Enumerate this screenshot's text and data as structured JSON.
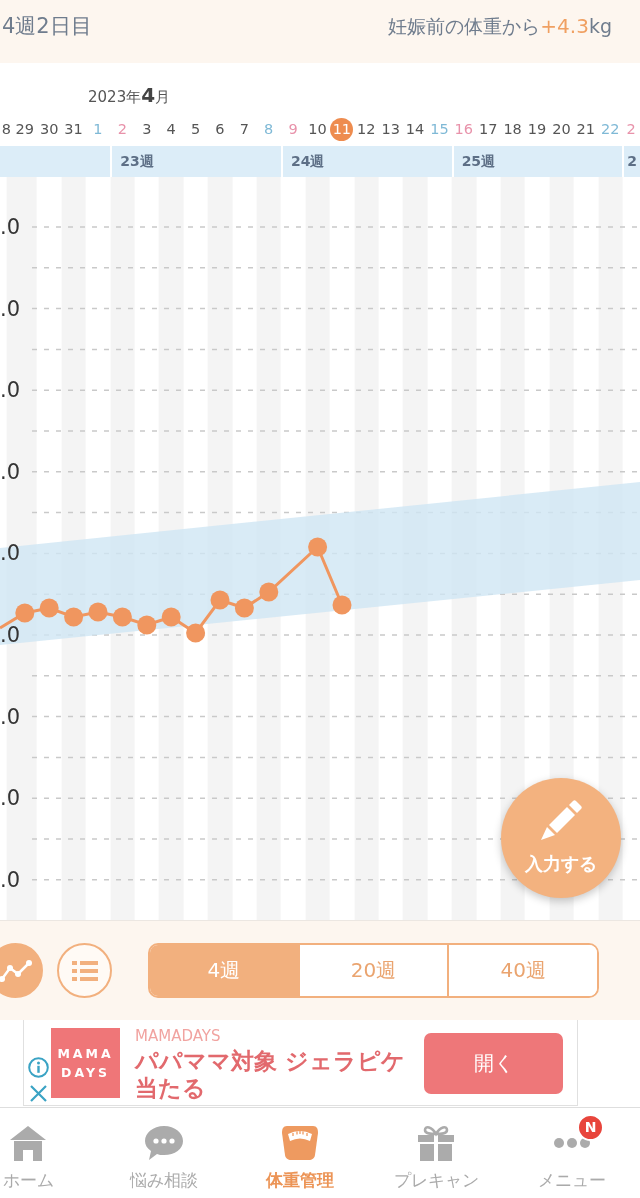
{
  "header": {
    "week_day": "4週2日目",
    "gain_label": "妊娠前の体重から",
    "gain_value": "+4.3",
    "gain_unit": "kg"
  },
  "calendar": {
    "month": "2023年**4**月",
    "days": [
      {
        "label": "8",
        "kind": "weekday",
        "today": false
      },
      {
        "label": "29",
        "kind": "weekday",
        "today": false
      },
      {
        "label": "30",
        "kind": "weekday",
        "today": false
      },
      {
        "label": "31",
        "kind": "weekday",
        "today": false
      },
      {
        "label": "1",
        "kind": "saturday",
        "today": false
      },
      {
        "label": "2",
        "kind": "sunday",
        "today": false
      },
      {
        "label": "3",
        "kind": "weekday",
        "today": false
      },
      {
        "label": "4",
        "kind": "weekday",
        "today": false
      },
      {
        "label": "5",
        "kind": "weekday",
        "today": false
      },
      {
        "label": "6",
        "kind": "weekday",
        "today": false
      },
      {
        "label": "7",
        "kind": "weekday",
        "today": false
      },
      {
        "label": "8",
        "kind": "saturday",
        "today": false
      },
      {
        "label": "9",
        "kind": "sunday",
        "today": false
      },
      {
        "label": "10",
        "kind": "weekday",
        "today": false
      },
      {
        "label": "11",
        "kind": "weekday",
        "today": true
      },
      {
        "label": "12",
        "kind": "weekday",
        "today": false
      },
      {
        "label": "13",
        "kind": "weekday",
        "today": false
      },
      {
        "label": "14",
        "kind": "weekday",
        "today": false
      },
      {
        "label": "15",
        "kind": "saturday",
        "today": false
      },
      {
        "label": "16",
        "kind": "sunday",
        "today": false
      },
      {
        "label": "17",
        "kind": "weekday",
        "today": false
      },
      {
        "label": "18",
        "kind": "weekday",
        "today": false
      },
      {
        "label": "19",
        "kind": "weekday",
        "today": false
      },
      {
        "label": "20",
        "kind": "weekday",
        "today": false
      },
      {
        "label": "21",
        "kind": "weekday",
        "today": false
      },
      {
        "label": "22",
        "kind": "saturday",
        "today": false
      },
      {
        "label": "2",
        "kind": "sunday",
        "today": false
      }
    ],
    "weeks": [
      "23週",
      "24週",
      "25週",
      "2"
    ]
  },
  "chart": {
    "y_labels": [
      ".0",
      ".0",
      ".0",
      ".0",
      ".0",
      ".0",
      ".0",
      ".0",
      ".0"
    ]
  },
  "input_button": {
    "label": "入力する"
  },
  "view_toggle": [
    {
      "kind": "graph",
      "selected": true
    },
    {
      "kind": "list",
      "selected": false
    }
  ],
  "range_tabs": [
    {
      "label": "4週",
      "selected": true
    },
    {
      "label": "20週",
      "selected": false
    },
    {
      "label": "40週",
      "selected": false
    }
  ],
  "ad": {
    "logo": "MAMA DAYS",
    "advertiser": "MAMADAYS",
    "headline": "パパママ対象 ジェラピケ当たる",
    "button": "開く"
  },
  "tab_bar": [
    {
      "kind": "home",
      "label": "ホーム",
      "selected": false
    },
    {
      "kind": "chat",
      "label": "悩み相談",
      "selected": false
    },
    {
      "kind": "scale",
      "label": "体重管理",
      "selected": true
    },
    {
      "kind": "gift",
      "label": "プレキャン",
      "selected": false
    },
    {
      "kind": "menu",
      "label": "メニュー",
      "selected": false,
      "badge": "N"
    }
  ]
}
